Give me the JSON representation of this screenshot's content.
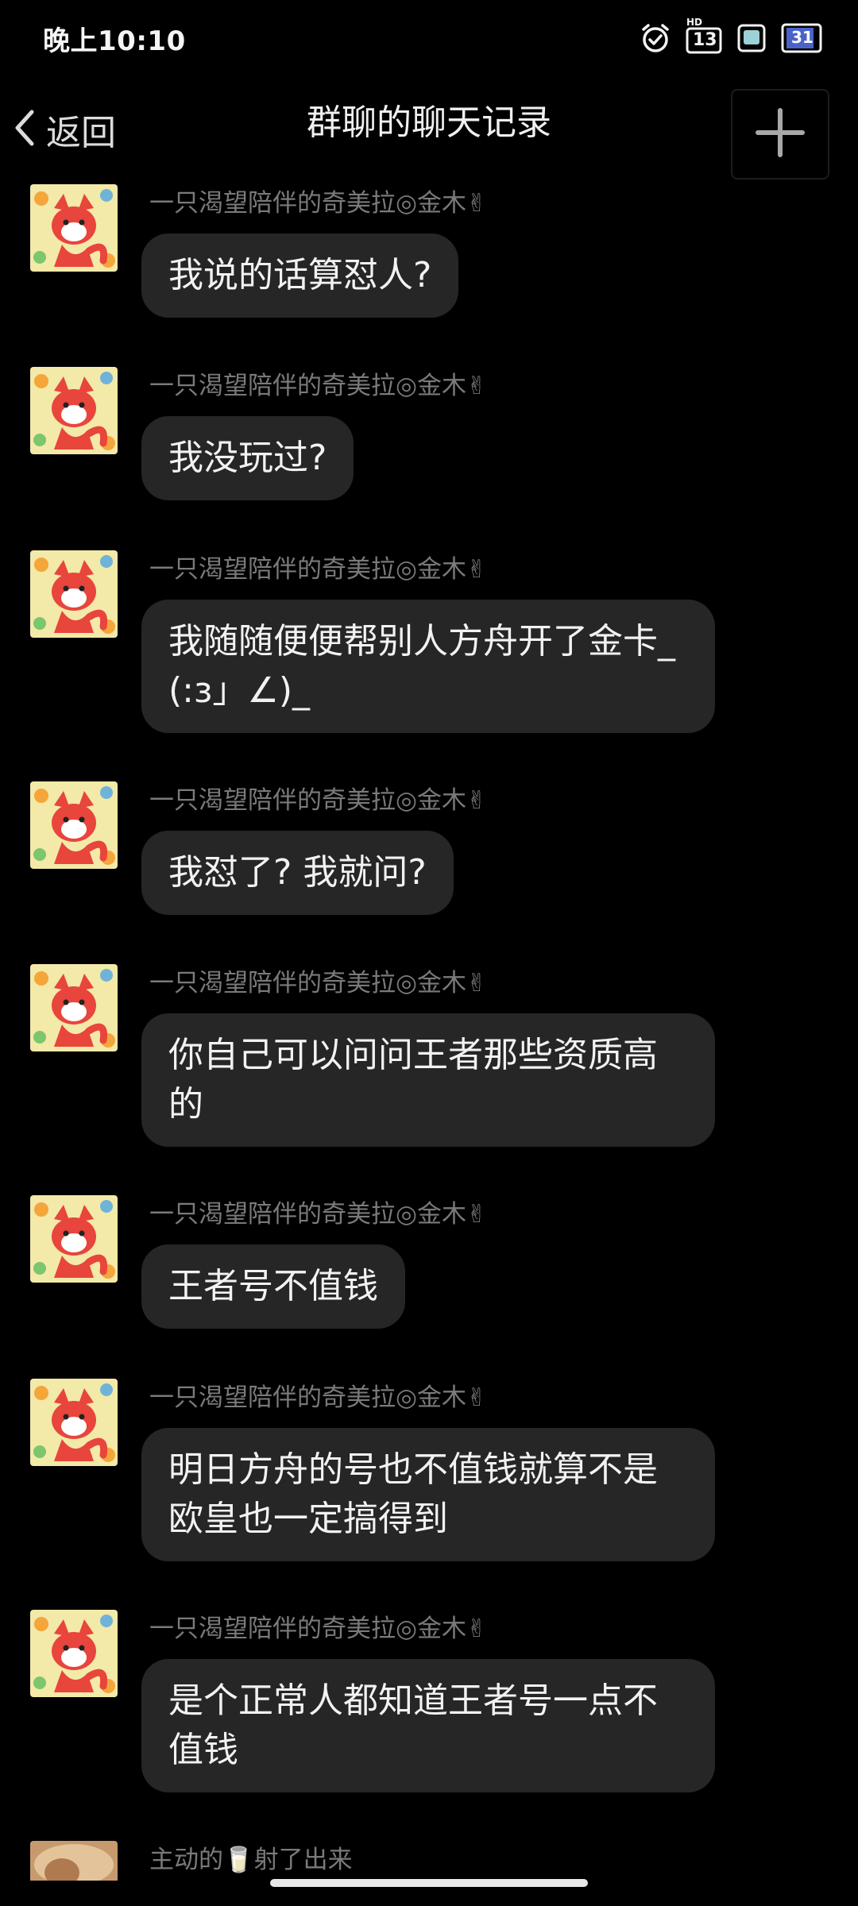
{
  "status_bar": {
    "time": "晚上10:10",
    "hd_label": "HD",
    "signal_label": "13",
    "calendar_day": "31"
  },
  "nav": {
    "back_label": "返回",
    "title": "群聊的聊天记录"
  },
  "messages": [
    {
      "sender": "一只渴望陪伴的奇美拉◎金木✌",
      "text": "我说的话算怼人?"
    },
    {
      "sender": "一只渴望陪伴的奇美拉◎金木✌",
      "text": "我没玩过?"
    },
    {
      "sender": "一只渴望陪伴的奇美拉◎金木✌",
      "text": "我随随便便帮别人方舟开了金卡_(:з」∠)_"
    },
    {
      "sender": "一只渴望陪伴的奇美拉◎金木✌",
      "text": "我怼了? 我就问?"
    },
    {
      "sender": "一只渴望陪伴的奇美拉◎金木✌",
      "text": "你自己可以问问王者那些资质高的"
    },
    {
      "sender": "一只渴望陪伴的奇美拉◎金木✌",
      "text": "王者号不值钱"
    },
    {
      "sender": "一只渴望陪伴的奇美拉◎金木✌",
      "text": "明日方舟的号也不值钱就算不是欧皇也一定搞得到"
    },
    {
      "sender": "一只渴望陪伴的奇美拉◎金木✌",
      "text": "是个正常人都知道王者号一点不值钱"
    },
    {
      "sender": "主动的🥛射了出来",
      "text": ""
    }
  ],
  "colors": {
    "background": "#000000",
    "bubble": "#262626",
    "sender_text": "#7a7a7a",
    "avatar_bg": "#f3e9a8",
    "avatar_fox": "#e8453c"
  }
}
